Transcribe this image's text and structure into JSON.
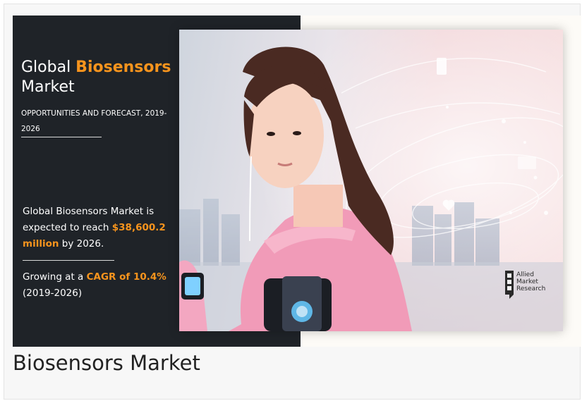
{
  "banner": {
    "title_prefix": "Global ",
    "title_accent": "Biosensors",
    "title_line2": "Market",
    "subtitle": "OPPORTUNITIES AND FORECAST, 2019-2026",
    "stat1_a": "Global Biosensors Market is expected to reach ",
    "stat1_value": "$38,600.2 million",
    "stat1_b": " by 2026.",
    "stat2_a": "Growing at a ",
    "stat2_value": "CAGR of 10.4%",
    "stat2_b": "(2019-2026)",
    "logo": {
      "line1": "Allied",
      "line2": "Market",
      "line3": "Research",
      "icon": "allied-market-research-logo"
    },
    "colors": {
      "panel": "#1f2328",
      "accent": "#f7941d"
    }
  },
  "caption": "Biosensors Market"
}
